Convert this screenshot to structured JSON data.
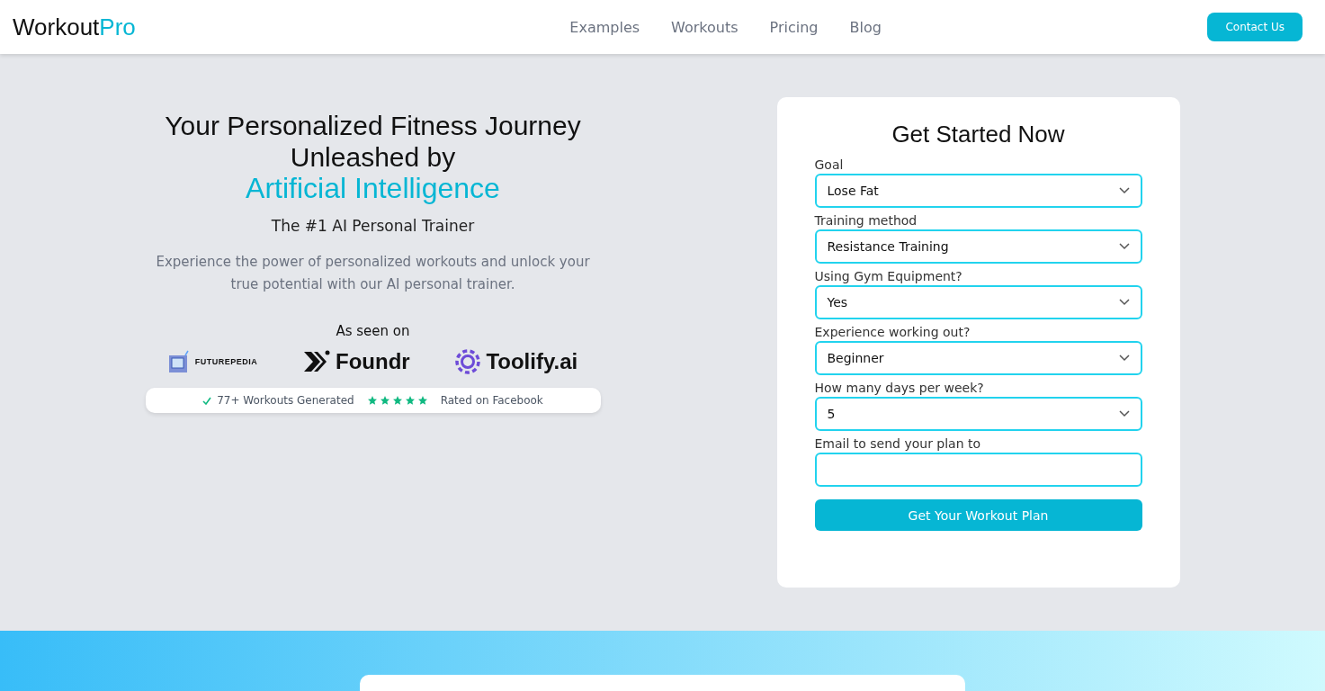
{
  "header": {
    "brand": "Workout",
    "brand_accent": "Pro",
    "nav": [
      "Examples",
      "Workouts",
      "Pricing",
      "Blog"
    ],
    "cta": "Contact Us"
  },
  "hero": {
    "title": "Your Personalized Fitness Journey Unleashed by",
    "title_accent": "Artificial Intelligence",
    "subtitle": "The #1 AI Personal Trainer",
    "description": "Experience the power of personalized workouts and unlock your true potential with our AI personal trainer.",
    "seen_on": "As seen on",
    "logos": [
      {
        "kind": "futurepedia",
        "name": "FUTUREPEDIA"
      },
      {
        "kind": "foundr",
        "name": "Foundr"
      },
      {
        "kind": "toolify",
        "name": "Toolify.ai"
      }
    ],
    "proof": {
      "count": "77+ Workouts Generated",
      "stars": 5,
      "rating": "Rated on Facebook"
    }
  },
  "form": {
    "title": "Get Started Now",
    "fields": [
      {
        "kind": "select",
        "label": "Goal",
        "value": "Lose Fat"
      },
      {
        "kind": "select",
        "label": "Training method",
        "value": "Resistance Training"
      },
      {
        "kind": "select",
        "label": "Using Gym Equipment?",
        "value": "Yes"
      },
      {
        "kind": "select",
        "label": "Experience working out?",
        "value": "Beginner"
      },
      {
        "kind": "select",
        "label": "How many days per week?",
        "value": "5"
      },
      {
        "kind": "input",
        "label": "Email to send your plan to"
      }
    ],
    "submit": "Get Your Workout Plan"
  }
}
